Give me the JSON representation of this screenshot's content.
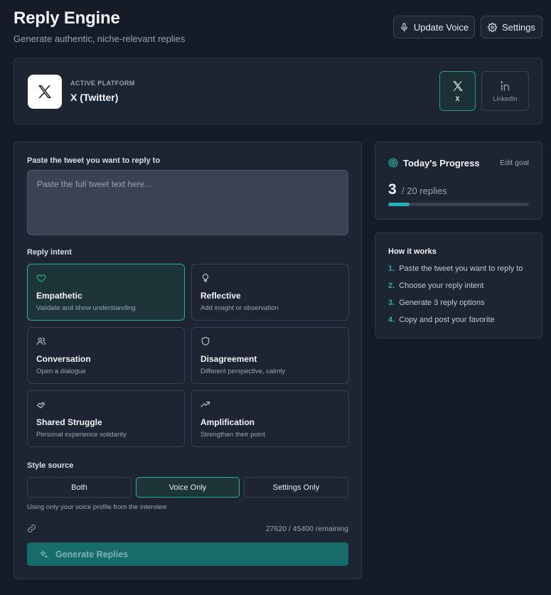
{
  "header": {
    "title": "Reply Engine",
    "subtitle": "Generate authentic, niche-relevant replies",
    "update_voice_label": "Update Voice",
    "settings_label": "Settings"
  },
  "platform": {
    "kicker": "ACTIVE PLATFORM",
    "name": "X (Twitter)",
    "options": [
      {
        "label": "X",
        "icon": "x-logo-icon",
        "selected": true
      },
      {
        "label": "LinkedIn",
        "icon": "linkedin-icon",
        "selected": false
      }
    ]
  },
  "compose": {
    "tweet_label": "Paste the tweet you want to reply to",
    "tweet_placeholder": "Paste the full tweet text here...",
    "tweet_value": "",
    "intent_label": "Reply intent",
    "intents": [
      {
        "title": "Empathetic",
        "desc": "Validate and show understanding",
        "icon": "heart-icon",
        "selected": true
      },
      {
        "title": "Reflective",
        "desc": "Add insight or observation",
        "icon": "lightbulb-icon",
        "selected": false
      },
      {
        "title": "Conversation",
        "desc": "Open a dialogue",
        "icon": "users-icon",
        "selected": false
      },
      {
        "title": "Disagreement",
        "desc": "Different perspective, calmly",
        "icon": "shield-icon",
        "selected": false
      },
      {
        "title": "Shared Struggle",
        "desc": "Personal experience solidarity",
        "icon": "handshake-icon",
        "selected": false
      },
      {
        "title": "Amplification",
        "desc": "Strengthen their point",
        "icon": "trending-up-icon",
        "selected": false
      }
    ],
    "style_label": "Style source",
    "style_options": [
      "Both",
      "Voice Only",
      "Settings Only"
    ],
    "style_selected": "Voice Only",
    "style_note": "Using only your voice profile from the interview",
    "remaining": "27620 / 45400 remaining",
    "generate_label": "Generate Replies"
  },
  "progress": {
    "title": "Today's Progress",
    "edit_label": "Edit goal",
    "count": "3",
    "goal_text": "/ 20 replies",
    "fraction": 0.15
  },
  "how_it_works": {
    "title": "How it works",
    "steps": [
      {
        "num": "1.",
        "text": "Paste the tweet you want to reply to"
      },
      {
        "num": "2.",
        "text": "Choose your reply intent"
      },
      {
        "num": "3.",
        "text": "Generate 3 reply options"
      },
      {
        "num": "4.",
        "text": "Copy and post your favorite"
      }
    ]
  },
  "colors": {
    "accent": "#22b3a0",
    "background": "#151b27",
    "card": "#1e2532",
    "generate_button": "#176b69"
  }
}
